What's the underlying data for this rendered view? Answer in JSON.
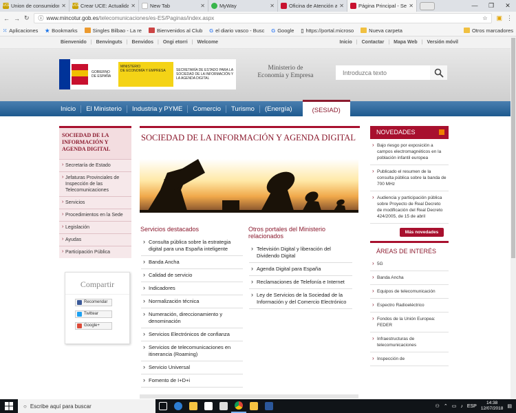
{
  "browser": {
    "tabs": [
      {
        "label": "Union de consumidor",
        "icon": "uce-icon"
      },
      {
        "label": "Crear UCE: Actualidad",
        "icon": "uce-icon"
      },
      {
        "label": "New Tab",
        "icon": "blank-page-icon"
      },
      {
        "label": "MyWay",
        "icon": "myway-icon"
      },
      {
        "label": "Oficina de Atención a",
        "icon": "ministry-icon"
      },
      {
        "label": "Página Principal - Sec",
        "icon": "ministry-icon",
        "active": true
      }
    ],
    "url_domain": "www.mincotur.gob.es",
    "url_path": "/telecomunicaciones/es-ES/Paginas/index.aspx",
    "bookmarks": [
      "Aplicaciones",
      "Bookmarks",
      "Singles Bilbao - La re",
      "Bienvenidos al Club",
      "el diario vasco - Busc",
      "Google",
      "https://portal.microso",
      "Nueva carpeta"
    ],
    "other_bookmarks": "Otros marcadores"
  },
  "site": {
    "top_left_links": [
      "Bienvenido",
      "Benvinguts",
      "Benvidos",
      "Ongi etorri",
      "Welcome"
    ],
    "top_right_links": [
      "Inicio",
      "Contactar",
      "Mapa Web",
      "Versión móvil"
    ],
    "gov_line1": "GOBIERNO",
    "gov_line2": "DE ESPAÑA",
    "ministry_short_1": "MINISTERIO",
    "ministry_short_2": "DE ECONOMÍA Y EMPRESA",
    "secretaria": "SECRETARÍA DE ESTADO PARA LA SOCIEDAD DE LA INFORMACIÓN Y LA AGENDA DIGITAL",
    "ministry_line1": "Ministerio de",
    "ministry_line2": "Economía y Empresa",
    "search_placeholder": "Introduzca texto",
    "nav": [
      "Inicio",
      "El Ministerio",
      "Industria y PYME",
      "Comercio",
      "Turismo",
      "(Energía)"
    ],
    "nav_active": "(SESIAD)",
    "left_title": "SOCIEDAD DE LA INFORMACIÓN Y AGENDA DIGITAL",
    "left_items": [
      "Secretaría de Estado",
      "Jefaturas Provinciales de Inspección de las Telecomunicaciones",
      "Servicios",
      "Procedimientos en la Sede",
      "Legislación",
      "Ayudas",
      "Participación Pública"
    ],
    "share_title": "Compartir",
    "share_buttons": [
      "Recomendar",
      "Twittear",
      "Google+"
    ],
    "main_title": "SOCIEDAD DE LA INFORMACIÓN Y AGENDA DIGITAL",
    "featured_title": "Servicios destacados",
    "featured_items": [
      "Consulta pública sobre la estrategia digital para una España inteligente",
      "Banda Ancha",
      "Calidad de servicio",
      "Indicadores",
      "Normalización técnica",
      "Numeración, direccionamiento y denominación",
      "Servicios Electrónicos de confianza",
      "Servicios de telecomunicaciones en itinerancia (Roaming)",
      "Servicio Universal",
      "Fomento de I+D+i"
    ],
    "portals_title": "Otros portales del Ministerio relacionados",
    "portals_items": [
      "Televisión Digital y liberación del Dividendo Digital",
      "Agenda Digital para España",
      "Reclamaciones de Telefonía e Internet",
      "Ley de Servicios de la Sociedad de la Información y del Comercio Electrónico"
    ],
    "news_title": "NOVEDADES",
    "news_items": [
      "Bajo riesgo por exposición a campos electromagnéticos en la población infantil europea",
      "Publicado el resumen de la consulta pública sobre la banda de 700 MHz",
      "Audiencia y participación pública sobre Proyecto de Real Decreto de modificación del Real Decreto 424/2005, de 15 de abril"
    ],
    "more_news": "Más novedades",
    "areas_title": "ÁREAS DE INTERÉS",
    "areas_items": [
      "5G",
      "Banda Ancha",
      "Equipos de telecomunicación",
      "Espectro Radioeléctrico",
      "Fondos de la Unión Europea: FEDER",
      "Infraestructuras de telecomunicaciones",
      "Inspección de"
    ]
  },
  "taskbar": {
    "search_placeholder": "Escribe aquí para buscar",
    "lang": "ESP",
    "time": "14:38",
    "date": "12/07/2018"
  }
}
